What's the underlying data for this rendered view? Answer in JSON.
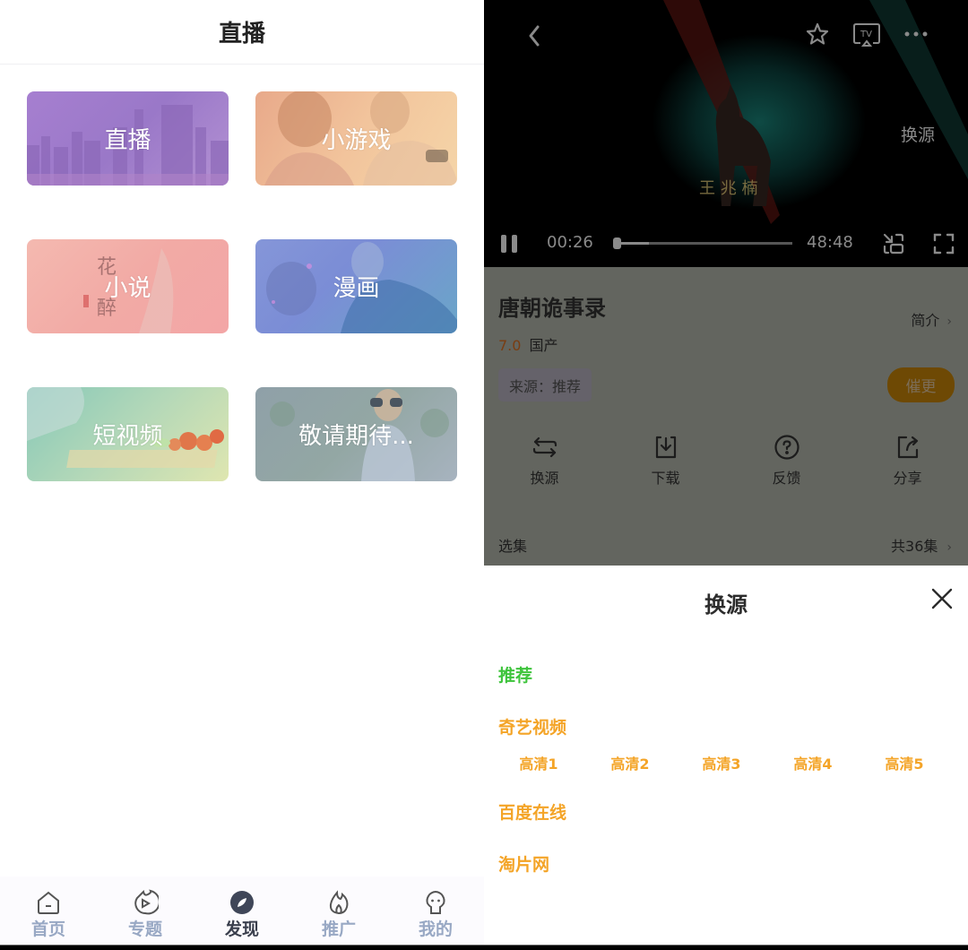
{
  "left": {
    "header": {
      "title": "直播"
    },
    "cards": [
      {
        "label": "直播",
        "theme": "city-skyline"
      },
      {
        "label": "小游戏",
        "theme": "couple-gaming"
      },
      {
        "label": "小说",
        "theme": "ancient-painting"
      },
      {
        "label": "漫画",
        "theme": "anime-hero"
      },
      {
        "label": "短视频",
        "theme": "cooking"
      },
      {
        "label": "敬请期待...",
        "theme": "child-binoculars"
      }
    ],
    "bottom_nav": {
      "items": [
        {
          "label": "首页",
          "icon": "home-icon",
          "active": false
        },
        {
          "label": "专题",
          "icon": "topic-play-icon",
          "active": false
        },
        {
          "label": "发现",
          "icon": "discover-compass-icon",
          "active": true
        },
        {
          "label": "推广",
          "icon": "flame-icon",
          "active": false
        },
        {
          "label": "我的",
          "icon": "profile-icon",
          "active": false
        }
      ],
      "inactive_color": "#98a8c4",
      "active_color": "#3a3f4d"
    }
  },
  "right": {
    "player": {
      "overlay_switch_source": "换源",
      "watermark_text": "王兆楠",
      "current_time": "00:26",
      "duration": "48:48",
      "progress_fraction": 0.009,
      "buffered_fraction": 0.19,
      "state": "playing"
    },
    "info": {
      "title": "唐朝诡事录",
      "intro_label": "简介",
      "rating": "7.0",
      "region": "国产",
      "source_tag": "来源：推荐",
      "urge_button": "催更",
      "actions": [
        {
          "label": "换源",
          "icon": "switch-source-icon"
        },
        {
          "label": "下载",
          "icon": "download-icon"
        },
        {
          "label": "反馈",
          "icon": "feedback-question-icon"
        },
        {
          "label": "分享",
          "icon": "share-icon"
        }
      ],
      "episodes_label": "选集",
      "episodes_count": "共36集"
    },
    "sheet": {
      "title": "换源",
      "sources": [
        {
          "name": "推荐",
          "active": true
        },
        {
          "name": "奇艺视频",
          "active": false,
          "qualities": [
            "高清1",
            "高清2",
            "高清3",
            "高清4",
            "高清5"
          ]
        },
        {
          "name": "百度在线",
          "active": false
        },
        {
          "name": "淘片网",
          "active": false
        }
      ],
      "active_color": "#3ec43c",
      "normal_color": "#f4a427"
    }
  }
}
